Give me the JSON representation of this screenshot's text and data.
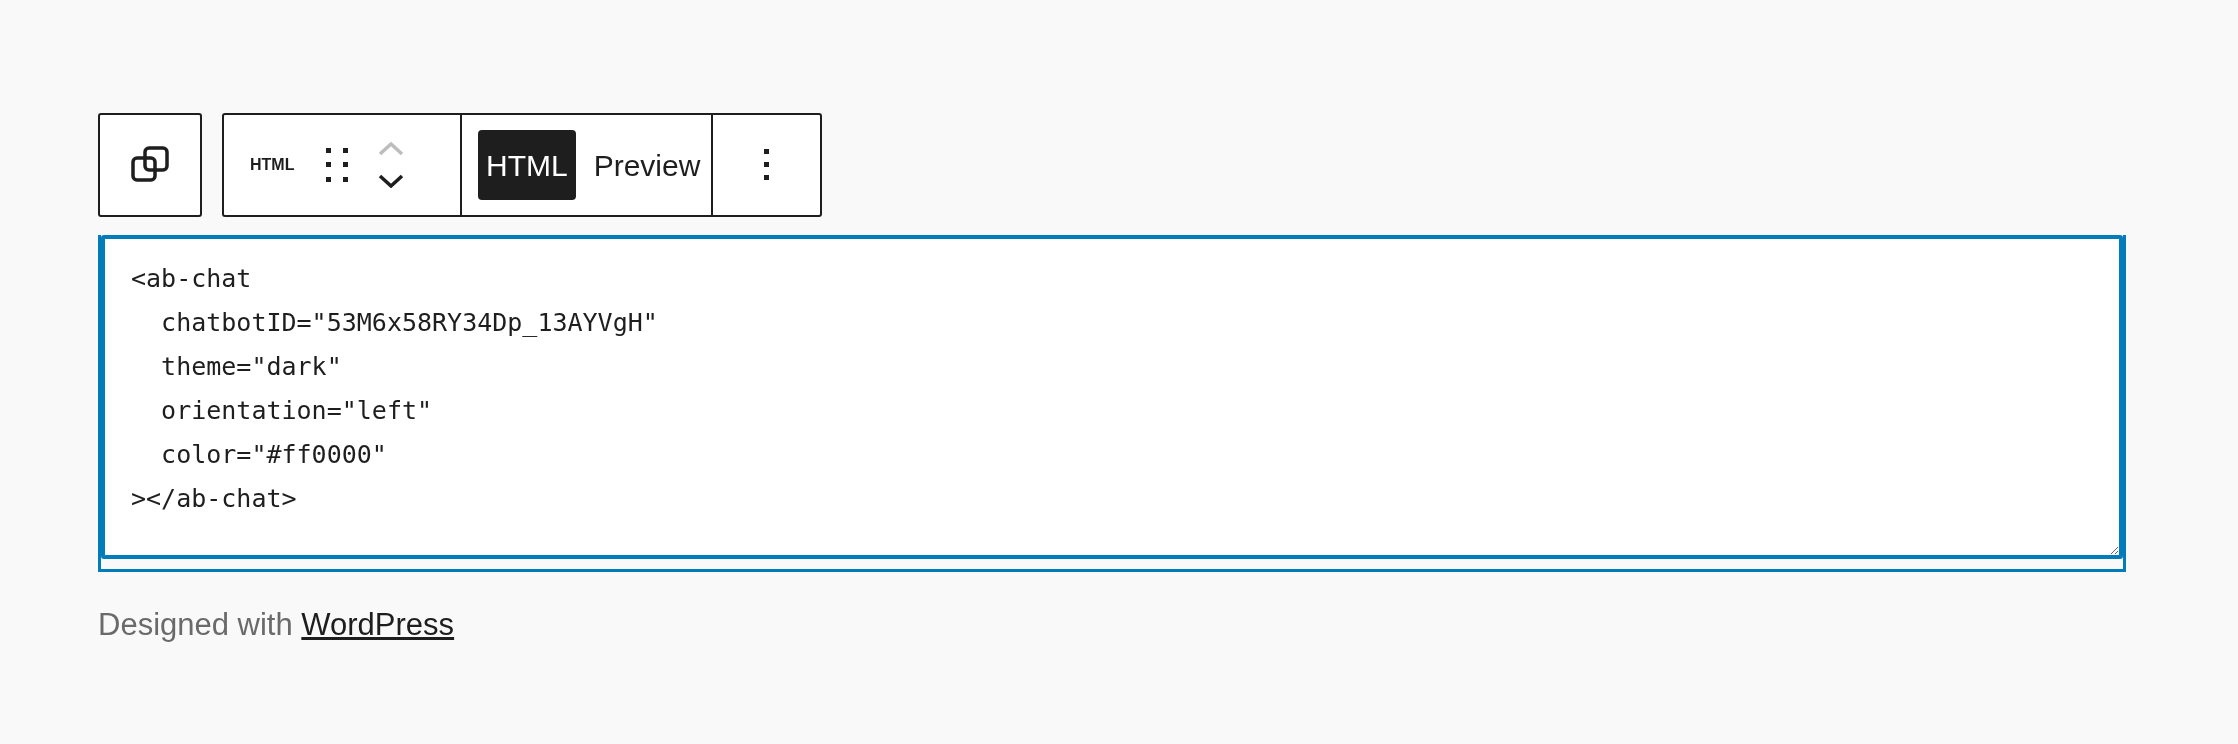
{
  "toolbar": {
    "block_label": "HTML",
    "move_up": {
      "disabled": true
    },
    "move_down": {
      "disabled": false
    },
    "tabs": [
      {
        "label": "HTML",
        "selected": true
      },
      {
        "label": "Preview",
        "selected": false
      }
    ]
  },
  "editor": {
    "value": "<ab-chat\n  chatbotID=\"53M6x58RY34Dp_13AYVgH\"\n  theme=\"dark\"\n  orientation=\"left\"\n  color=\"#ff0000\"\n></ab-chat>"
  },
  "footer": {
    "text": "Designed with",
    "link": "WordPress"
  }
}
